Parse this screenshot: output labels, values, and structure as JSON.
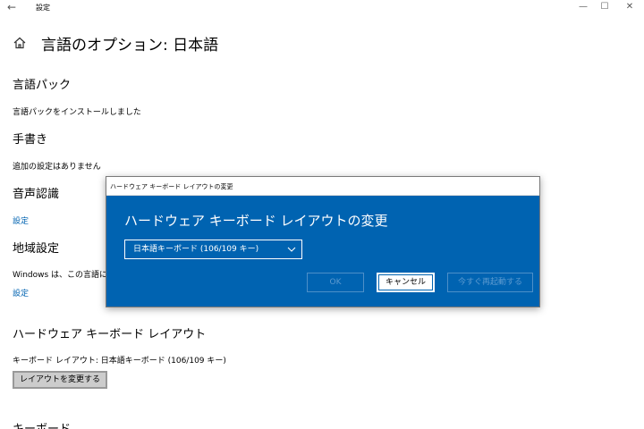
{
  "window": {
    "title": "設定",
    "back_glyph": "←",
    "minimize_glyph": "—",
    "maximize_glyph": "☐",
    "close_glyph": "✕"
  },
  "page": {
    "title": "言語のオプション: 日本語"
  },
  "sections": {
    "language_pack": {
      "title": "言語パック",
      "text": "言語パックをインストールしました"
    },
    "handwriting": {
      "title": "手書き",
      "text": "追加の設定はありません"
    },
    "speech": {
      "title": "音声認識",
      "link": "設定"
    },
    "region": {
      "title": "地域設定",
      "text": "Windows は、この言語に",
      "link": "設定"
    },
    "hardware_keyboard": {
      "title": "ハードウェア キーボード レイアウト",
      "text": "キーボード レイアウト: 日本語キーボード (106/109 キー)",
      "button": "レイアウトを変更する"
    },
    "keyboard_cut": {
      "title": "キーボード"
    }
  },
  "dialog": {
    "window_title": "ハードウェア キーボード レイアウトの変更",
    "heading": "ハードウェア キーボード レイアウトの変更",
    "select_value": "日本語キーボード (106/109 キー)",
    "ok_label": "OK",
    "cancel_label": "キャンセル",
    "restart_label": "今すぐ再起動する"
  },
  "colors": {
    "accent": "#0063b1",
    "link": "#0063b1"
  }
}
